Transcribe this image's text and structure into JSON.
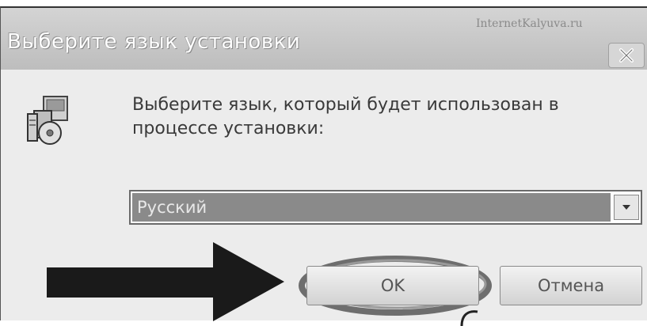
{
  "window": {
    "title": "Выберите язык установки",
    "watermark": "InternetKalyuva.ru",
    "close_icon": "close-icon"
  },
  "dialog": {
    "icon": "installer-icon",
    "prompt": "Выберите язык, который будет использован в процессе установки:"
  },
  "language_select": {
    "selected": "Русский",
    "arrow_icon": "chevron-down-icon"
  },
  "buttons": {
    "ok_label": "OK",
    "cancel_label": "Отмена"
  },
  "annotations": {
    "pointer": "arrow-pointer",
    "highlight": "ok-highlight-ring"
  },
  "colors": {
    "titlebar": "#c8c8c8",
    "selection": "#8a8a8a",
    "arrow": "#1a1a1a"
  }
}
